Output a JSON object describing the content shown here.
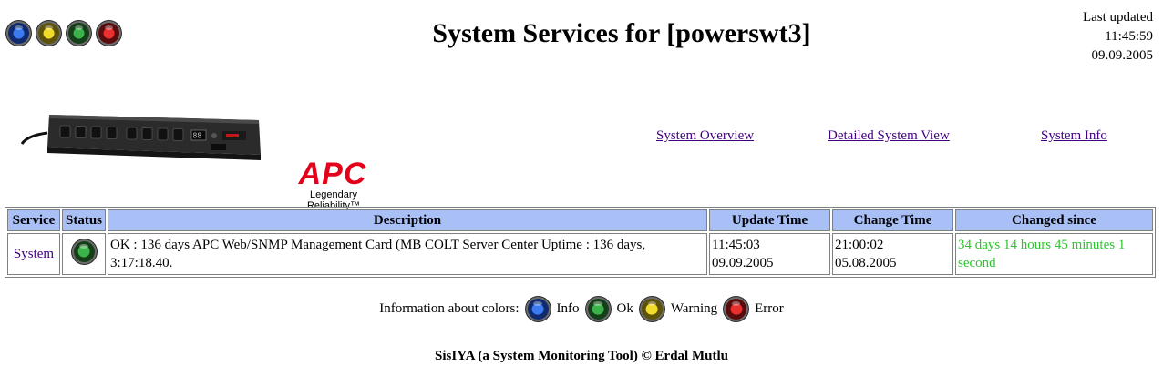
{
  "header": {
    "title": "System Services for [powerswt3]",
    "last_updated_label": "Last updated",
    "last_updated_time": "11:45:59",
    "last_updated_date": "09.09.2005"
  },
  "status_icons": [
    {
      "name": "info",
      "color": "#1e5bd6"
    },
    {
      "name": "warning",
      "color": "#e6d21c"
    },
    {
      "name": "ok",
      "color": "#2e9a3a"
    },
    {
      "name": "error",
      "color": "#d81e1e"
    }
  ],
  "device_logo": {
    "brand": "APC",
    "tagline": "Legendary Reliability™"
  },
  "nav": {
    "overview": "System Overview",
    "detailed": "Detailed System View",
    "info": "System Info"
  },
  "table": {
    "headers": [
      "Service",
      "Status",
      "Description",
      "Update Time",
      "Change Time",
      "Changed since"
    ],
    "rows": [
      {
        "service": "System",
        "status": "ok",
        "description": "OK : 136 days APC Web/SNMP Management Card (MB COLT Server Center Uptime : 136 days, 3:17:18.40.",
        "update_time": "11:45:03",
        "update_date": "09.09.2005",
        "change_time": "21:00:02",
        "change_date": "05.08.2005",
        "changed_since": "34 days 14 hours 45 minutes 1 second"
      }
    ]
  },
  "legend": {
    "label": "Information about colors:",
    "info": "Info",
    "ok": "Ok",
    "warning": "Warning",
    "error": "Error"
  },
  "footer": "SisIYA (a System Monitoring Tool) © Erdal Mutlu",
  "colors": {
    "header_bg": "#a9c0f7",
    "link": "#400080",
    "changed_since": "#2dc52d",
    "apc_red": "#e2001a"
  }
}
